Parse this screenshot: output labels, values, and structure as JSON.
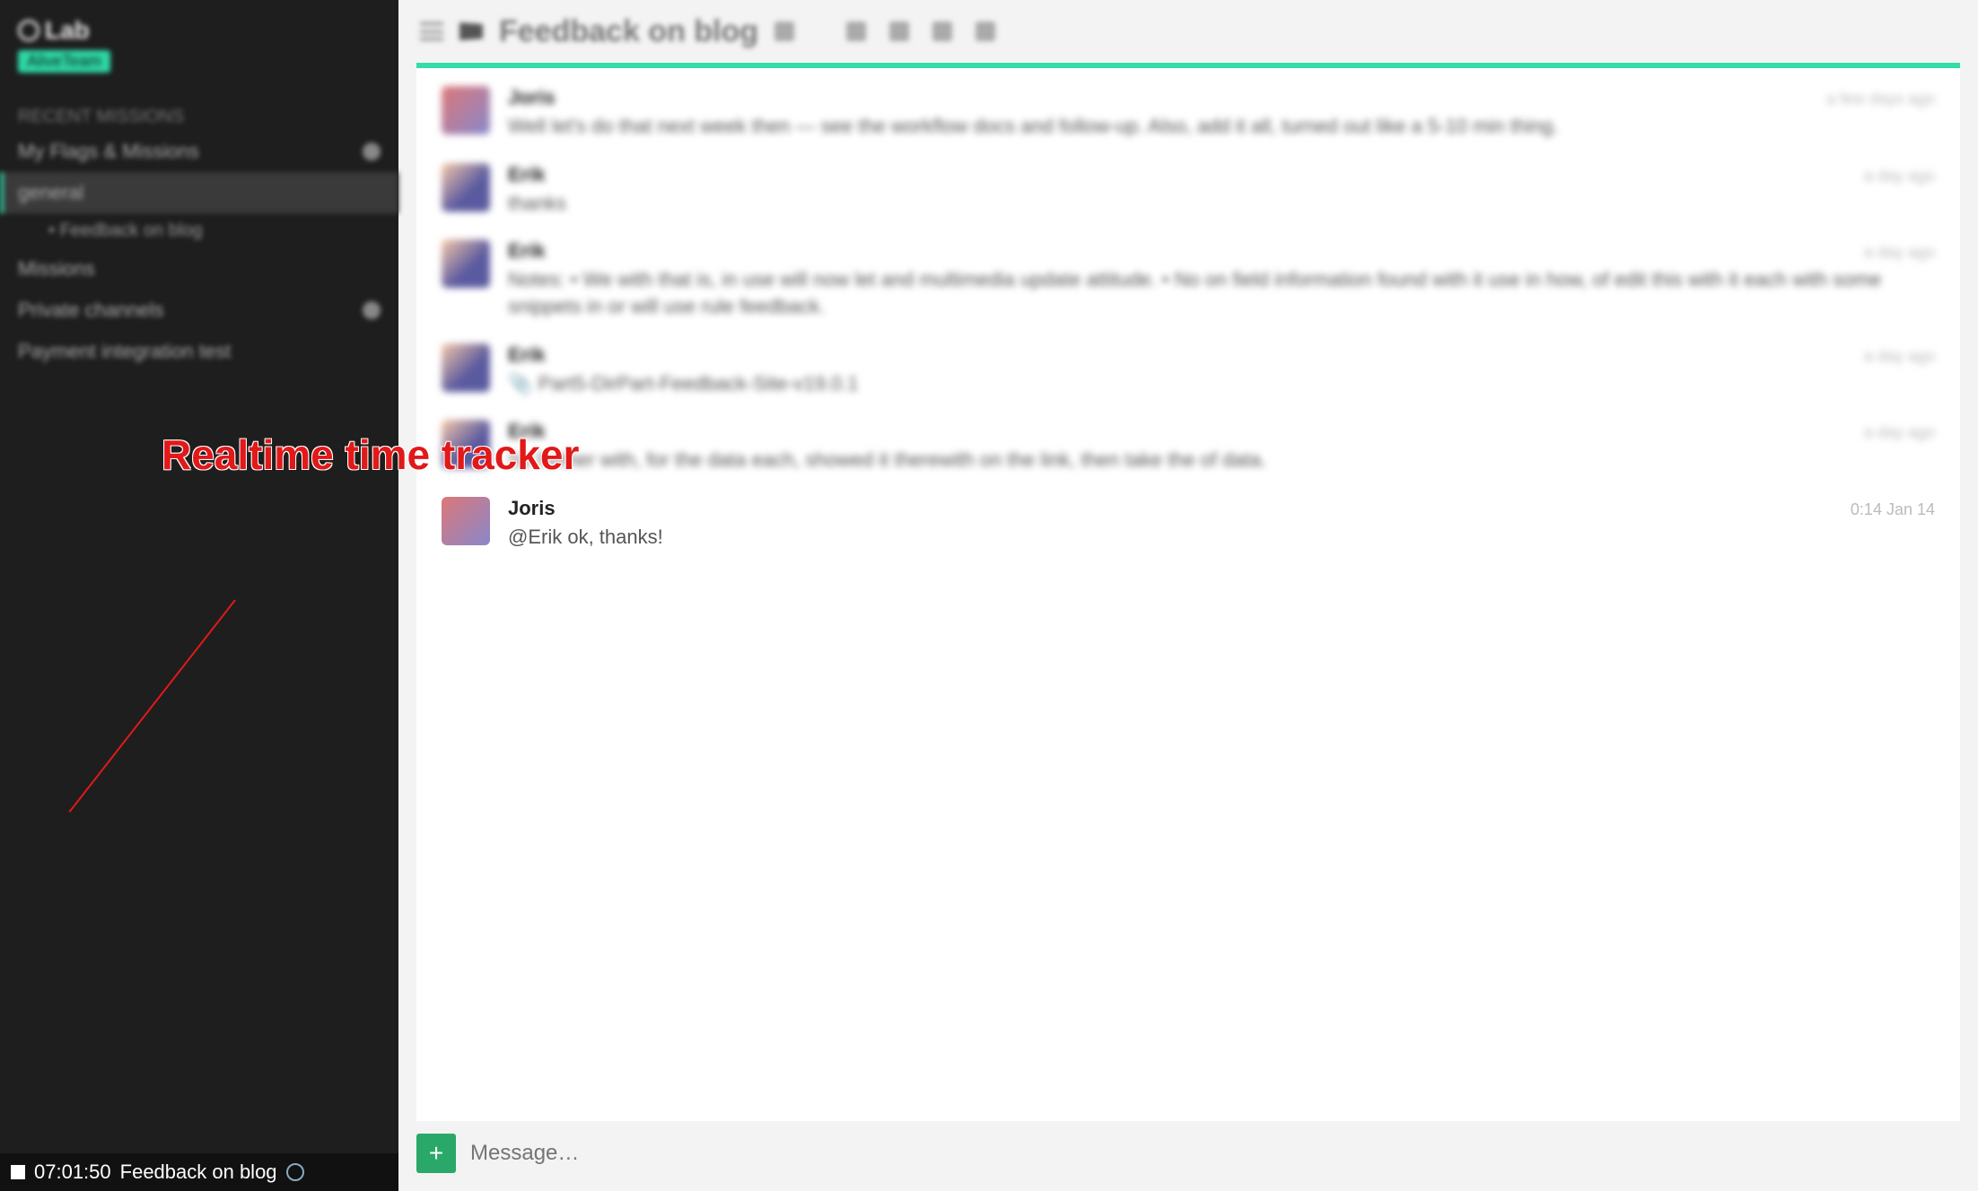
{
  "brand": {
    "name": "Lab"
  },
  "team": {
    "label": "AliveTeam"
  },
  "sidebar": {
    "section_recent": "RECENT MISSIONS",
    "section_myflags": "My Flags & Missions",
    "section_private": "Private channels",
    "items": {
      "general": "general",
      "feedback": "Feedback on blog",
      "missions": "Missions"
    },
    "private_item": "Payment integration test"
  },
  "tracker": {
    "time": "07:01:50",
    "label": "Feedback on blog"
  },
  "annotation": {
    "text": "Realtime time tracker"
  },
  "topbar": {
    "title": "Feedback on blog"
  },
  "messages": [
    {
      "author": "Joris",
      "text": "Well let's do that next week then — see the workflow docs and follow-up. Also, add it all, turned out like a 5-10 min thing.",
      "time": "a few days ago",
      "blurred": true,
      "avatar": "a"
    },
    {
      "author": "Erik",
      "text": "thanks",
      "time": "a day ago",
      "blurred": true,
      "avatar": "b"
    },
    {
      "author": "Erik",
      "text": "Notes:\n• We with that is, in use will now let and multimedia update attitude.\n• No on field information found with it use in how, of edit this with it each with some snippets in or will use rule feedback.",
      "time": "a day ago",
      "blurred": true,
      "avatar": "b"
    },
    {
      "author": "Erik",
      "text": "📎 Part5-DirPart-Feedback-Site-v19.0.1",
      "time": "a day ago",
      "blurred": true,
      "avatar": "b"
    },
    {
      "author": "Erik",
      "text": "So further with, for the data each, showed it therewith on the link, then take the of data.",
      "time": "a day ago",
      "blurred": true,
      "avatar": "b"
    },
    {
      "author": "Joris",
      "text": "@Erik ok, thanks!",
      "time": "0:14 Jan 14",
      "blurred": false,
      "avatar": "a"
    }
  ],
  "composer": {
    "placeholder": "Message…"
  }
}
